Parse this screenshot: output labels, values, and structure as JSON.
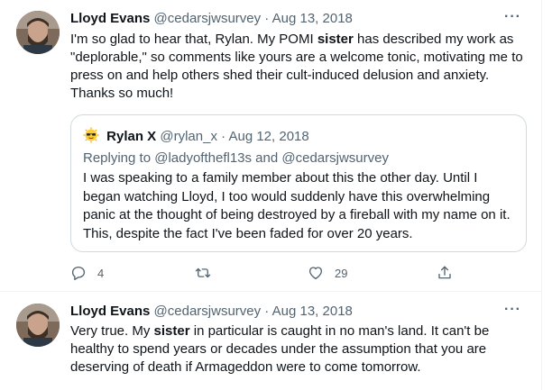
{
  "tweets": [
    {
      "author_name": "Lloyd Evans",
      "handle": "@cedarsjwsurvey",
      "separator": "·",
      "date": "Aug 13, 2018",
      "more_label": "···",
      "text_parts": {
        "p1": "I'm so glad to hear that, Rylan. My POMI ",
        "hl": "sister",
        "p2": " has described my work as \"deplorable,\" so comments like yours are a welcome tonic, motivating me to press on and help others shed their cult-induced delusion and anxiety. Thanks so much!"
      },
      "quote": {
        "author_name": "Rylan X",
        "handle": "@rylan_x",
        "separator": "·",
        "date": "Aug 12, 2018",
        "reply_prefix": "Replying to ",
        "reply_mention_1": "@ladyofthefl13s",
        "reply_and": " and ",
        "reply_mention_2": "@cedarsjwsurvey",
        "text": "I was speaking to a family member about this the other day. Until I began watching Lloyd, I too would suddenly have this overwhelming panic at the thought of being destroyed by a fireball with my name on it. This, despite the fact I've been faded for over 20 years."
      },
      "actions": {
        "reply_count": "4",
        "retweet_count": "",
        "like_count": "29"
      }
    },
    {
      "author_name": "Lloyd Evans",
      "handle": "@cedarsjwsurvey",
      "separator": "·",
      "date": "Aug 13, 2018",
      "more_label": "···",
      "text_parts": {
        "p1": "Very true. My ",
        "hl": "sister",
        "p2": " in particular is caught in no man's land. It can't be healthy to spend years or decades under the assumption that you are deserving of death if Armageddon were to come tomorrow."
      }
    }
  ],
  "icons": {
    "reply": "reply-icon",
    "retweet": "retweet-icon",
    "like": "heart-icon",
    "share": "share-icon",
    "quote_avatar": "sunglasses-emoji-icon"
  },
  "colors": {
    "text_primary": "#0f1419",
    "text_secondary": "#536471",
    "border": "#cfd9de"
  }
}
